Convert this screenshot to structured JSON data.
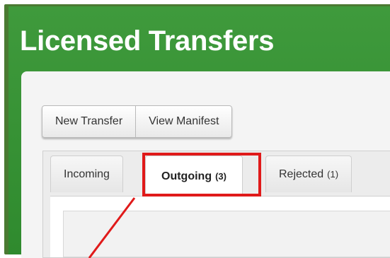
{
  "page": {
    "title": "Licensed Transfers"
  },
  "toolbar": {
    "new_transfer_label": "New Transfer",
    "view_manifest_label": "View Manifest"
  },
  "tabs": [
    {
      "label": "Incoming",
      "count": "",
      "active": false
    },
    {
      "label": "Outgoing",
      "count": "(3)",
      "active": true
    },
    {
      "label": "Rejected",
      "count": "(1)",
      "active": false
    }
  ],
  "colors": {
    "header_green": "#2f8a2e",
    "frame_green": "#4a7a32",
    "highlight_red": "#e01a1a"
  }
}
